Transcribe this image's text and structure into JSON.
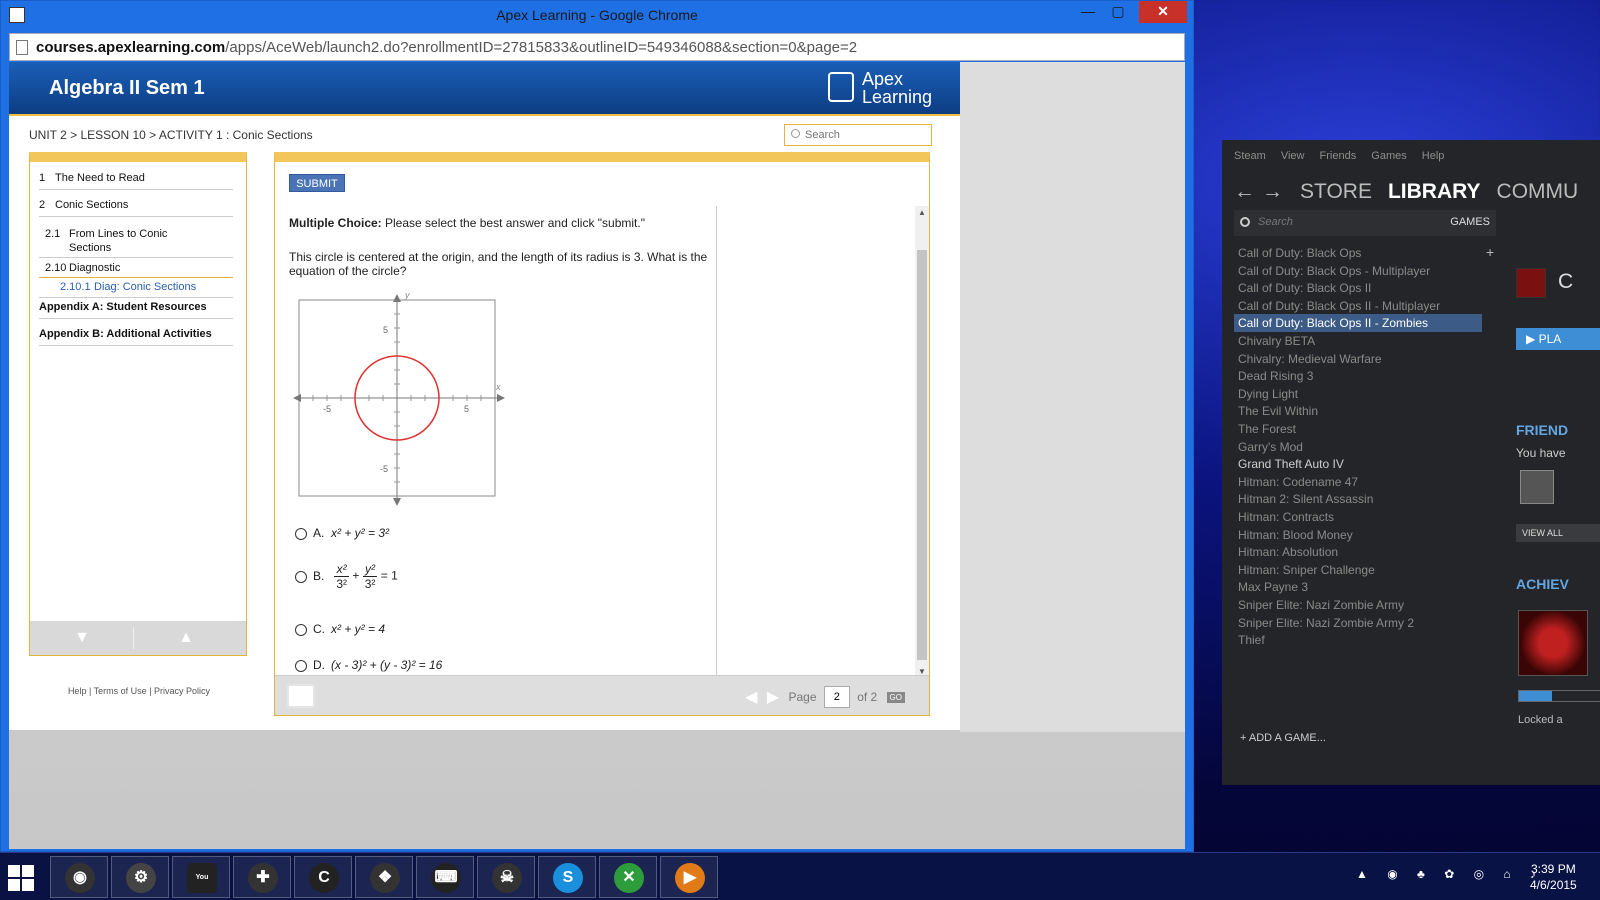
{
  "window": {
    "title": "Apex Learning - Google Chrome",
    "minimize": "—",
    "maximize": "▢",
    "close": "✕"
  },
  "address": {
    "host": "courses.apexlearning.com",
    "path": "/apps/AceWeb/launch2.do?enrollmentID=27815833&outlineID=549346088&section=0&page=2"
  },
  "apex": {
    "course_title": "Algebra II Sem 1",
    "logo_line1": "Apex",
    "logo_line2": "Learning",
    "breadcrumb": "UNIT 2 > LESSON 10 > ACTIVITY 1 : Conic Sections",
    "search_placeholder": "Search",
    "toc": [
      {
        "num": "1",
        "label": "The Need to Read"
      },
      {
        "num": "2",
        "label": "Conic Sections"
      },
      {
        "num": "2.1",
        "label": "From Lines to Conic"
      },
      {
        "num": "",
        "label": "Sections"
      },
      {
        "num": "2.10",
        "label": "Diagnostic"
      },
      {
        "num": "2.10.1",
        "label": "Diag: Conic Sections"
      },
      {
        "num": "",
        "label": "Appendix A: Student Resources"
      },
      {
        "num": "",
        "label": "Appendix B: Additional Activities"
      }
    ],
    "nav_down": "▼",
    "nav_up": "▲",
    "footer": {
      "help": "Help",
      "sep1": "|",
      "terms": "Terms of Use",
      "sep2": "|",
      "privacy": "Privacy Policy"
    },
    "submit_label": "SUBMIT",
    "mc_bold": "Multiple Choice:",
    "mc_text": " Please select the best answer and click \"submit.\"",
    "question": "This circle is centered at the origin, and the length of its radius is 3. What is the equation of the circle?",
    "graph": {
      "x_label": "x",
      "y_label": "y",
      "tick_pos_x": "5",
      "tick_neg_x": "-5",
      "tick_pos_y": "5",
      "tick_neg_y": "-5",
      "radius": 3,
      "axis_range": [
        -7,
        7
      ],
      "circle_color": "#e03030"
    },
    "answers": {
      "a_letter": "A.",
      "a_text": "x² + y² = 3²",
      "b_letter": "B.",
      "b_num1": "x²",
      "b_den1": "3²",
      "b_plus": "+",
      "b_num2": "y²",
      "b_den2": "3²",
      "b_eq": "= 1",
      "c_letter": "C.",
      "c_text": "x² + y² = 4",
      "d_letter": "D.",
      "d_text": "(x - 3)² + (y - 3)² = 16"
    },
    "pager": {
      "page_label": "Page",
      "page_value": "2",
      "of_label": "of 2",
      "go": "GO"
    }
  },
  "steam": {
    "menu": "Steam View Friends Games Help",
    "nav_back": "←",
    "nav_forward": "→",
    "store": "STORE",
    "library": "LIBRARY",
    "community": "COMMU",
    "search_placeholder": "Search",
    "games_label": "GAMES",
    "add_plus": "+",
    "games": [
      {
        "name": "Call of Duty: Black Ops",
        "state": "uninstalled"
      },
      {
        "name": "Call of Duty: Black Ops - Multiplayer",
        "state": "uninstalled"
      },
      {
        "name": "Call of Duty: Black Ops II",
        "state": "uninstalled"
      },
      {
        "name": "Call of Duty: Black Ops II - Multiplayer",
        "state": "uninstalled"
      },
      {
        "name": "Call of Duty: Black Ops II - Zombies",
        "state": "selected"
      },
      {
        "name": "Chivalry BETA",
        "state": "uninstalled"
      },
      {
        "name": "Chivalry: Medieval Warfare",
        "state": "uninstalled"
      },
      {
        "name": "Dead Rising 3",
        "state": "uninstalled"
      },
      {
        "name": "Dying Light",
        "state": "uninstalled"
      },
      {
        "name": "The Evil Within",
        "state": "uninstalled"
      },
      {
        "name": "The Forest",
        "state": "uninstalled"
      },
      {
        "name": "Garry's Mod",
        "state": "uninstalled"
      },
      {
        "name": "Grand Theft Auto IV",
        "state": "installed"
      },
      {
        "name": "Hitman: Codename 47",
        "state": "uninstalled"
      },
      {
        "name": "Hitman 2: Silent Assassin",
        "state": "uninstalled"
      },
      {
        "name": "Hitman: Contracts",
        "state": "uninstalled"
      },
      {
        "name": "Hitman: Blood Money",
        "state": "uninstalled"
      },
      {
        "name": "Hitman: Absolution",
        "state": "uninstalled"
      },
      {
        "name": "Hitman: Sniper Challenge",
        "state": "uninstalled"
      },
      {
        "name": "Max Payne 3",
        "state": "uninstalled"
      },
      {
        "name": "Sniper Elite: Nazi Zombie Army",
        "state": "uninstalled"
      },
      {
        "name": "Sniper Elite: Nazi Zombie Army 2",
        "state": "uninstalled"
      },
      {
        "name": "Thief",
        "state": "uninstalled"
      }
    ],
    "detail_initial": "C",
    "play": "▶ PLA",
    "friends_header": "FRIEND",
    "friends_text": "You have",
    "view_all": "VIEW ALL",
    "achievements_header": "ACHIEV",
    "achievement_progress": 0.4,
    "locked_text": "Locked a",
    "add_game": "+   ADD A GAME..."
  },
  "taskbar": {
    "apps": [
      {
        "icon": "steam-icon",
        "glyph": "◉",
        "color": "#333333"
      },
      {
        "icon": "steam-overlay-icon",
        "glyph": "⚙",
        "color": "#444444"
      },
      {
        "icon": "youtube-icon",
        "glyph": "You Tube",
        "color": "#222222"
      },
      {
        "icon": "crosshair-icon",
        "glyph": "✚",
        "color": "#333333"
      },
      {
        "icon": "ccleaner-icon",
        "glyph": "C",
        "color": "#222222"
      },
      {
        "icon": "dropbox-icon",
        "glyph": "❖",
        "color": "#333333"
      },
      {
        "icon": "keyboard-icon",
        "glyph": "⌨",
        "color": "#222222"
      },
      {
        "icon": "skull-icon",
        "glyph": "☠",
        "color": "#333333"
      },
      {
        "icon": "skype-icon",
        "glyph": "S",
        "color": "#1a8fdc"
      },
      {
        "icon": "xbox-icon",
        "glyph": "✕",
        "color": "#2c9d3a"
      },
      {
        "icon": "media-player-icon",
        "glyph": "▶",
        "color": "#e07b18"
      }
    ],
    "tray": "▲ ◉ ♣ ✿ ◎ ⌂ ♪",
    "time": "3:39 PM",
    "date": "4/6/2015"
  }
}
